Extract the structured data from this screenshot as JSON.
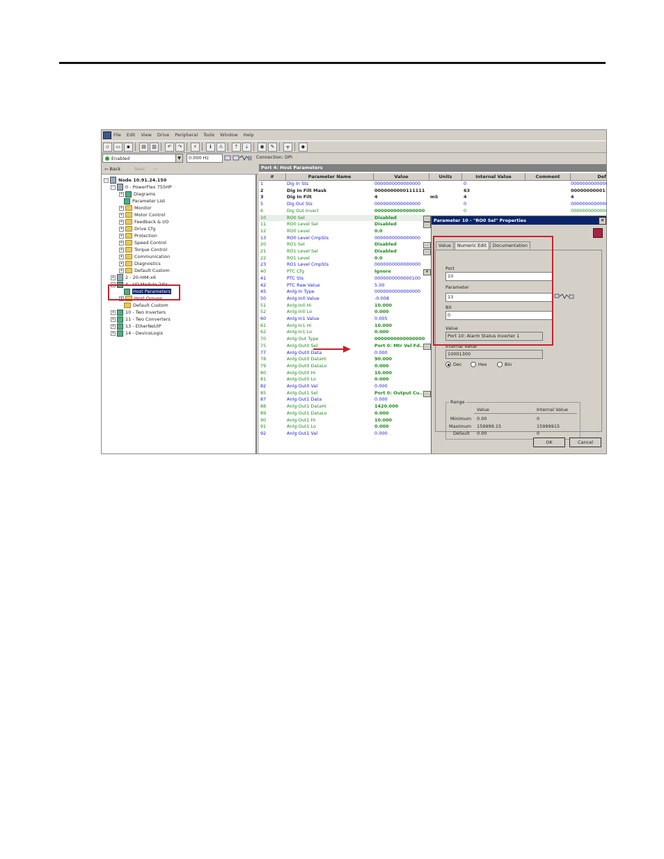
{
  "menu": {
    "items": [
      "File",
      "Edit",
      "View",
      "Drive",
      "Peripheral",
      "Tools",
      "Window",
      "Help"
    ]
  },
  "status": {
    "drive_state": "Enabled",
    "frequency": "0.000 Hz",
    "connection": "Connection: DPI"
  },
  "nav": {
    "back": "Back",
    "next": "Next"
  },
  "tree": {
    "node": "Node 10.91.24.150",
    "items": [
      "0 - PowerFlex 755HP",
      "Diagrams",
      "Parameter List",
      "Monitor",
      "Motor Control",
      "Feedback & I/O",
      "Drive Cfg",
      "Protection",
      "Speed Control",
      "Torque Control",
      "Communication",
      "Diagnostics",
      "Default Custom",
      "2 - 20-HIM-x6",
      "4 - I/O Module 24V",
      "Host Parameters",
      "Host Groups",
      "Default Custom",
      "10 - Two Inverters",
      "11 - Two Converters",
      "13 - EtherNet/IP",
      "14 - DeviceLogix"
    ]
  },
  "grid": {
    "title": "Port 4: Host Parameters",
    "headers": [
      "#",
      "Parameter Name",
      "Value",
      "Units",
      "Internal Value",
      "Comment",
      "Defau"
    ],
    "rows": [
      {
        "num": "1",
        "name": "Dig In Sts",
        "value": "0000000000000000",
        "units": "",
        "internal": "0",
        "default": "0000000000000",
        "color": "blue"
      },
      {
        "num": "2",
        "name": "Dig In Filt Mask",
        "value": "0000000000111111",
        "units": "",
        "internal": "63",
        "default": "0000000000111",
        "color": "black"
      },
      {
        "num": "3",
        "name": "Dig In Filt",
        "value": "4",
        "units": "mS",
        "internal": "4",
        "default": "4",
        "color": "black"
      },
      {
        "num": "5",
        "name": "Dig Out Sts",
        "value": "0000000000000000",
        "units": "",
        "internal": "0",
        "default": "0000000000000",
        "color": "blue"
      },
      {
        "num": "6",
        "name": "Dig Out Invert",
        "value": "0000000000000000",
        "units": "",
        "internal": "0",
        "default": "0000000000000",
        "color": "green"
      },
      {
        "num": "10",
        "name": "RO0 Sel",
        "value": "Disabled",
        "units": "",
        "internal": "",
        "default": "",
        "color": "green"
      },
      {
        "num": "11",
        "name": "RO0 Level Sel",
        "value": "Disabled",
        "units": "",
        "internal": "",
        "default": "",
        "color": "green"
      },
      {
        "num": "12",
        "name": "RO0 Level",
        "value": "0.0",
        "units": "",
        "internal": "",
        "default": "",
        "color": "green"
      },
      {
        "num": "13",
        "name": "RO0 Level CmpSts",
        "value": "0000000000000000",
        "units": "",
        "internal": "",
        "default": "",
        "color": "blue"
      },
      {
        "num": "20",
        "name": "RO1 Sel",
        "value": "Disabled",
        "units": "",
        "internal": "",
        "default": "",
        "color": "green"
      },
      {
        "num": "21",
        "name": "RO1 Level Sel",
        "value": "Disabled",
        "units": "",
        "internal": "",
        "default": "",
        "color": "green"
      },
      {
        "num": "22",
        "name": "RO1 Level",
        "value": "0.0",
        "units": "",
        "internal": "",
        "default": "",
        "color": "green"
      },
      {
        "num": "23",
        "name": "RO1 Level CmpSts",
        "value": "0000000000000000",
        "units": "",
        "internal": "",
        "default": "",
        "color": "blue"
      },
      {
        "num": "40",
        "name": "PTC Cfg",
        "value": "Ignore",
        "units": "",
        "internal": "",
        "default": "",
        "color": "green"
      },
      {
        "num": "41",
        "name": "PTC Sts",
        "value": "0000000000000100",
        "units": "",
        "internal": "",
        "default": "",
        "color": "blue"
      },
      {
        "num": "42",
        "name": "PTC Raw Value",
        "value": "5.00",
        "units": "",
        "internal": "",
        "default": "",
        "color": "blue"
      },
      {
        "num": "45",
        "name": "Anlg In Type",
        "value": "0000000000000000",
        "units": "",
        "internal": "",
        "default": "",
        "color": "blue"
      },
      {
        "num": "50",
        "name": "Anlg In0 Value",
        "value": "-0.008",
        "units": "",
        "internal": "",
        "default": "",
        "color": "blue"
      },
      {
        "num": "51",
        "name": "Anlg In0 Hi",
        "value": "10.000",
        "units": "",
        "internal": "",
        "default": "",
        "color": "green"
      },
      {
        "num": "52",
        "name": "Anlg In0 Lo",
        "value": "0.000",
        "units": "",
        "internal": "",
        "default": "",
        "color": "green"
      },
      {
        "num": "60",
        "name": "Anlg In1 Value",
        "value": "0.005",
        "units": "",
        "internal": "",
        "default": "",
        "color": "blue"
      },
      {
        "num": "61",
        "name": "Anlg In1 Hi",
        "value": "10.000",
        "units": "",
        "internal": "",
        "default": "",
        "color": "green"
      },
      {
        "num": "62",
        "name": "Anlg In1 Lo",
        "value": "0.000",
        "units": "",
        "internal": "",
        "default": "",
        "color": "green"
      },
      {
        "num": "70",
        "name": "Anlg Out Type",
        "value": "0000000000000000",
        "units": "",
        "internal": "",
        "default": "",
        "color": "green"
      },
      {
        "num": "75",
        "name": "Anlg Out0 Sel",
        "value": "Port 0: Mtr Vel Fd...",
        "units": "",
        "internal": "",
        "default": "",
        "color": "green"
      },
      {
        "num": "77",
        "name": "Anlg Out0 Data",
        "value": "0.000",
        "units": "",
        "internal": "",
        "default": "",
        "color": "blue"
      },
      {
        "num": "78",
        "name": "Anlg Out0 DataHi",
        "value": "90.000",
        "units": "",
        "internal": "",
        "default": "",
        "color": "green"
      },
      {
        "num": "79",
        "name": "Anlg Out0 DataLo",
        "value": "0.000",
        "units": "",
        "internal": "",
        "default": "",
        "color": "green"
      },
      {
        "num": "80",
        "name": "Anlg Out0 Hi",
        "value": "10.000",
        "units": "",
        "internal": "",
        "default": "",
        "color": "green"
      },
      {
        "num": "81",
        "name": "Anlg Out0 Lo",
        "value": "0.000",
        "units": "",
        "internal": "",
        "default": "",
        "color": "green"
      },
      {
        "num": "82",
        "name": "Anlg Out0 Val",
        "value": "0.000",
        "units": "",
        "internal": "",
        "default": "",
        "color": "blue"
      },
      {
        "num": "85",
        "name": "Anlg Out1 Sel",
        "value": "Port 0: Output Cu...",
        "units": "",
        "internal": "",
        "default": "",
        "color": "green"
      },
      {
        "num": "87",
        "name": "Anlg Out1 Data",
        "value": "0.000",
        "units": "",
        "internal": "",
        "default": "",
        "color": "blue"
      },
      {
        "num": "88",
        "name": "Anlg Out1 DataHi",
        "value": "1420.000",
        "units": "",
        "internal": "",
        "default": "",
        "color": "green"
      },
      {
        "num": "89",
        "name": "Anlg Out1 DataLo",
        "value": "0.000",
        "units": "",
        "internal": "",
        "default": "",
        "color": "green"
      },
      {
        "num": "90",
        "name": "Anlg Out1 Hi",
        "value": "10.000",
        "units": "",
        "internal": "",
        "default": "",
        "color": "green"
      },
      {
        "num": "91",
        "name": "Anlg Out1 Lo",
        "value": "0.000",
        "units": "",
        "internal": "",
        "default": "",
        "color": "green"
      },
      {
        "num": "92",
        "name": "Anlg Out1 Val",
        "value": "0.000",
        "units": "",
        "internal": "",
        "default": "",
        "color": "blue"
      }
    ]
  },
  "dialog": {
    "title": "Parameter 10 - \"RO0 Sel\" Properties",
    "tabs": [
      "Value",
      "Numeric Edit",
      "Documentation"
    ],
    "port_label": "Port",
    "port_value": "10",
    "parameter_label": "Parameter",
    "parameter_value": "13",
    "bit_label": "Bit",
    "bit_value": "0",
    "value_label": "Value",
    "value_text": "Port 10: Alarm Status Inverter 1",
    "internal_label": "Internal Value",
    "internal_value": "10001300",
    "radix": {
      "dec": "Dec",
      "hex": "Hex",
      "bin": "Bin",
      "selected": "Dec"
    },
    "range": {
      "label": "Range",
      "col_value": "Value",
      "col_internal": "Internal Value",
      "minimum_label": "Minimum",
      "maximum_label": "Maximum",
      "default_label": "Default",
      "min_value": "0.00",
      "min_internal": "0",
      "max_value": "159999.15",
      "max_internal": "15999915",
      "def_value": "0.00",
      "def_internal": "0"
    },
    "ok": "OK",
    "cancel": "Cancel"
  },
  "colors": {
    "highlight": "#c8202a",
    "title_bar": "#0a246a",
    "value_blue": "#1a1ad0",
    "value_green": "#1a8a1a"
  }
}
